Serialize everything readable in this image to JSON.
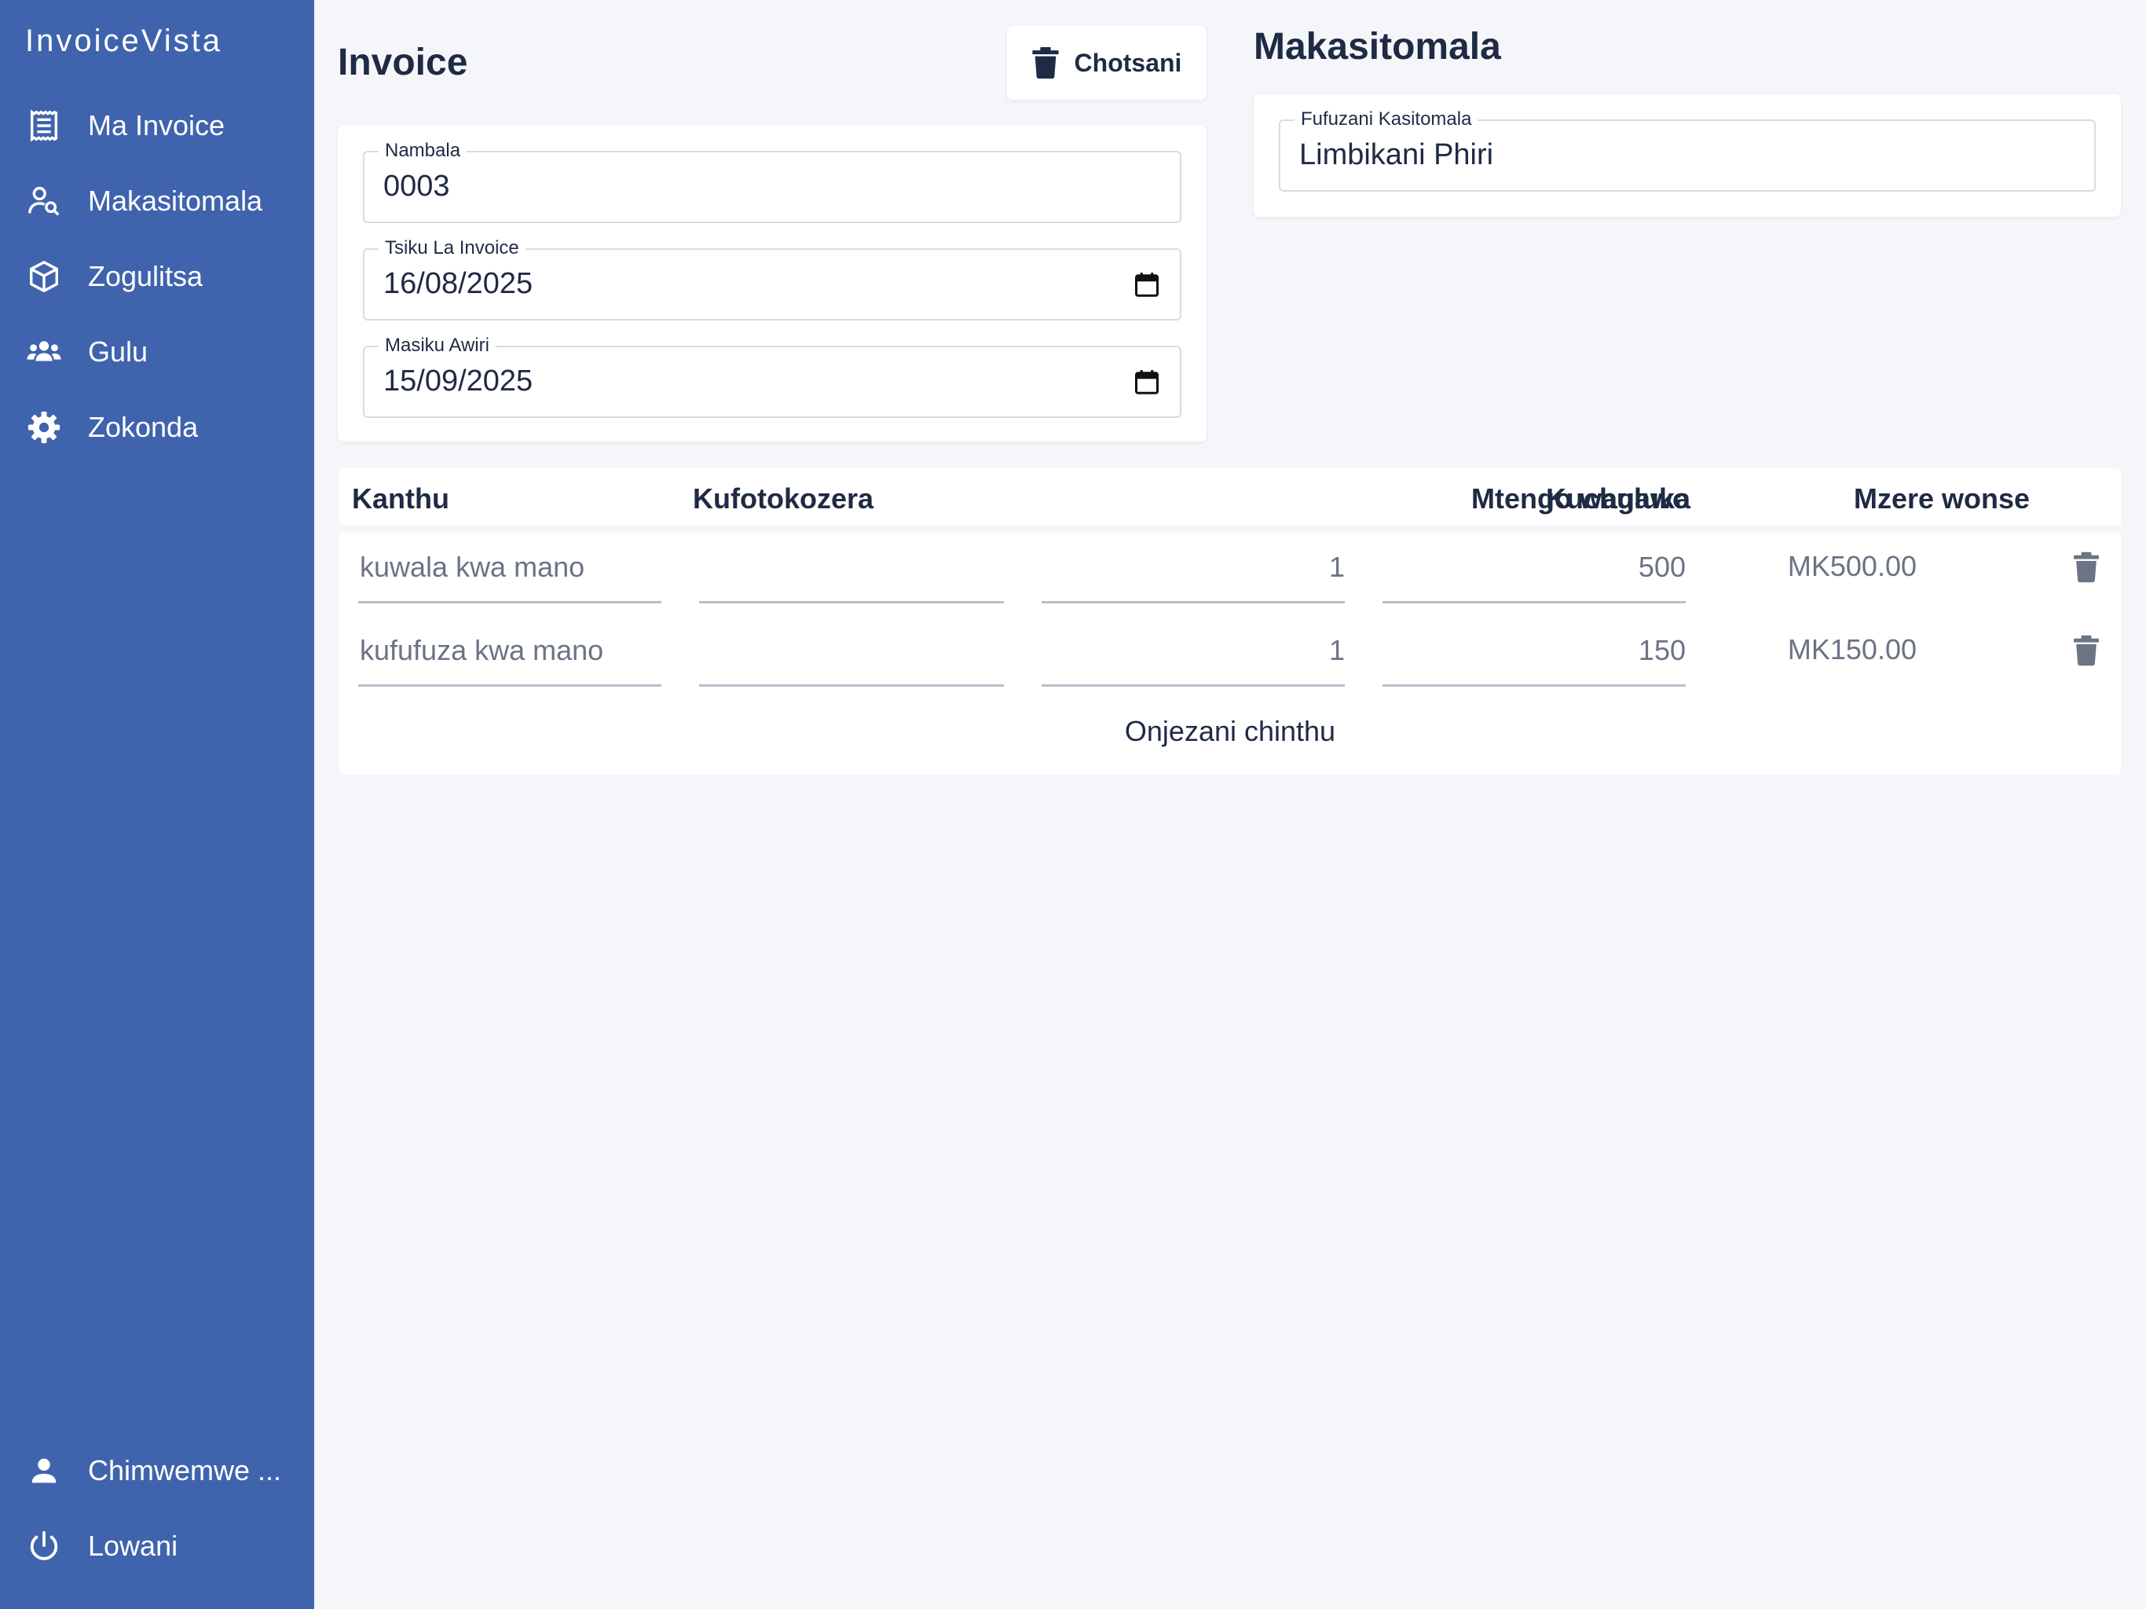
{
  "app": {
    "brand": "InvoiceVista"
  },
  "sidebar": {
    "items": [
      {
        "label": "Ma Invoice",
        "icon": "receipt-icon"
      },
      {
        "label": "Makasitomala",
        "icon": "person-search-icon"
      },
      {
        "label": "Zogulitsa",
        "icon": "box-icon"
      },
      {
        "label": "Gulu",
        "icon": "group-icon"
      },
      {
        "label": "Zokonda",
        "icon": "gear-icon"
      }
    ],
    "user": {
      "label": "Chimwemwe ...",
      "icon": "person-icon"
    },
    "logout": {
      "label": "Lowani",
      "icon": "power-icon"
    }
  },
  "invoice": {
    "title": "Invoice",
    "delete_label": "Chotsani",
    "number": {
      "label": "Nambala",
      "value": "0003"
    },
    "date": {
      "label": "Tsiku La Invoice",
      "value": "16/08/2025"
    },
    "due": {
      "label": "Masiku Awiri",
      "value": "15/09/2025"
    }
  },
  "customer": {
    "title": "Makasitomala",
    "search": {
      "label": "Fufuzani Kasitomala",
      "value": "Limbikani Phiri"
    }
  },
  "table": {
    "headers": {
      "item": "Kanthu",
      "description": "Kufotokozera",
      "quantity": "Kuchuluka",
      "unit_price": "Mtengo wagawo",
      "total": "Mzere wonse"
    },
    "rows": [
      {
        "item": "kuwala kwa mano",
        "description": "",
        "quantity": "1",
        "unit_price": "500",
        "total": "MK500.00"
      },
      {
        "item": "kufufuza kwa mano",
        "description": "",
        "quantity": "1",
        "unit_price": "150",
        "total": "MK150.00"
      }
    ],
    "add_label": "Onjezani chinthu"
  },
  "colors": {
    "sidebar": "#4063ad",
    "background": "#f4f6fa",
    "text": "#1f2a44",
    "muted": "#6b7384"
  }
}
